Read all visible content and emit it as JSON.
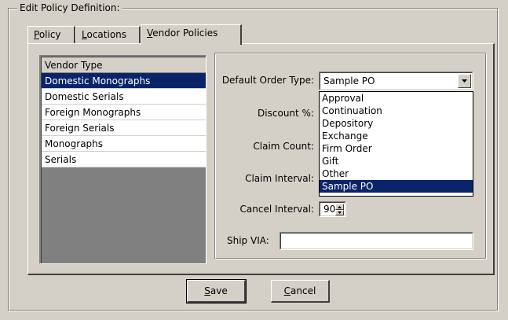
{
  "group": {
    "legend": "Edit Policy Definition:"
  },
  "tabs": [
    {
      "label": "Policy",
      "mnemonic": "P",
      "rest": "olicy"
    },
    {
      "label": "Locations",
      "mnemonic": "L",
      "rest": "ocations"
    },
    {
      "label": "Vendor Policies",
      "mnemonic": "V",
      "rest": "endor Policies"
    }
  ],
  "vendor_list": {
    "header": "Vendor Type",
    "items": [
      "Domestic Monographs",
      "Domestic Serials",
      "Foreign Monographs",
      "Foreign Serials",
      "Monographs",
      "Serials"
    ],
    "selected": "Domestic Monographs"
  },
  "form": {
    "default_order_type": {
      "label": "Default Order Type:",
      "value": "Sample PO"
    },
    "discount": {
      "label": "Discount %:"
    },
    "claim_count": {
      "label": "Claim Count:"
    },
    "claim_interval": {
      "label": "Claim Interval:"
    },
    "cancel_interval": {
      "label": "Cancel Interval:",
      "value": "90"
    },
    "ship_via": {
      "label": "Ship VIA:",
      "value": ""
    }
  },
  "dropdown": {
    "options": [
      "Approval",
      "Continuation",
      "Depository",
      "Exchange",
      "Firm Order",
      "Gift",
      "Other",
      "Sample PO"
    ],
    "selected": "Sample PO"
  },
  "buttons": {
    "save": {
      "label": "Save",
      "mnemonic": "S",
      "rest": "ave"
    },
    "cancel": {
      "label": "Cancel",
      "mnemonic": "C",
      "rest": "ancel"
    }
  },
  "colors": {
    "selection": "#0a246a",
    "face": "#d4d0c8"
  }
}
